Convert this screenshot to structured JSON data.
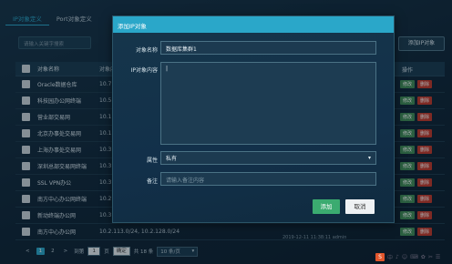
{
  "tabs": [
    {
      "label": "IP对象定义",
      "active": true
    },
    {
      "label": "Port对象定义",
      "active": false
    }
  ],
  "search": {
    "placeholder": "请输入关键字搜索"
  },
  "add_button": "添加IP对象",
  "table": {
    "headers": {
      "name": "对象名称",
      "content": "对象内容",
      "ops": "操作"
    },
    "rows": [
      {
        "name": "Oracle数据仓库",
        "content": "10.7"
      },
      {
        "name": "科技园办公网终端",
        "content": "10.5"
      },
      {
        "name": "营业部交易网",
        "content": "10.1"
      },
      {
        "name": "北京办事处交易网",
        "content": "10.1"
      },
      {
        "name": "上海办事处交易网",
        "content": "10.3"
      },
      {
        "name": "深圳总部交易网终端",
        "content": "10.3"
      },
      {
        "name": "SSL VPN办公",
        "content": "10.3"
      },
      {
        "name": "南方中心办公网终端",
        "content": "10.2"
      },
      {
        "name": "新动终端办公网",
        "content": "10.3"
      },
      {
        "name": "南方中心办公网",
        "content": "10.2.113.0/24, 10.2.128.0/24"
      }
    ],
    "edit_label": "修改",
    "delete_label": "删除"
  },
  "bottom_row_text": "2019-12-11 11:38:11   admin",
  "pager": {
    "prev": "<",
    "pages": [
      "1",
      "2"
    ],
    "next": ">",
    "goto_label": "到第",
    "goto_value": "1",
    "page_unit": "页",
    "confirm": "确定",
    "total": "共 18 条",
    "per_page": "10 条/页"
  },
  "modal": {
    "title": "添加IP对象",
    "name_label": "对象名称",
    "name_value": "数据库集群1",
    "content_label": "IP对象内容",
    "content_value": "|",
    "attr_label": "属性",
    "attr_value": "私有",
    "remark_label": "备注",
    "remark_placeholder": "请输入备注内容",
    "ok": "添加",
    "cancel": "取消"
  },
  "tray": {
    "s": "S",
    "items": [
      "中",
      "♪",
      "☺",
      "⌨",
      "✿",
      "✂",
      "☰"
    ]
  },
  "colors": {
    "accent": "#2aa7c9",
    "ok": "#3bab70",
    "delete": "#c0392b",
    "edit": "#3f8a56"
  }
}
